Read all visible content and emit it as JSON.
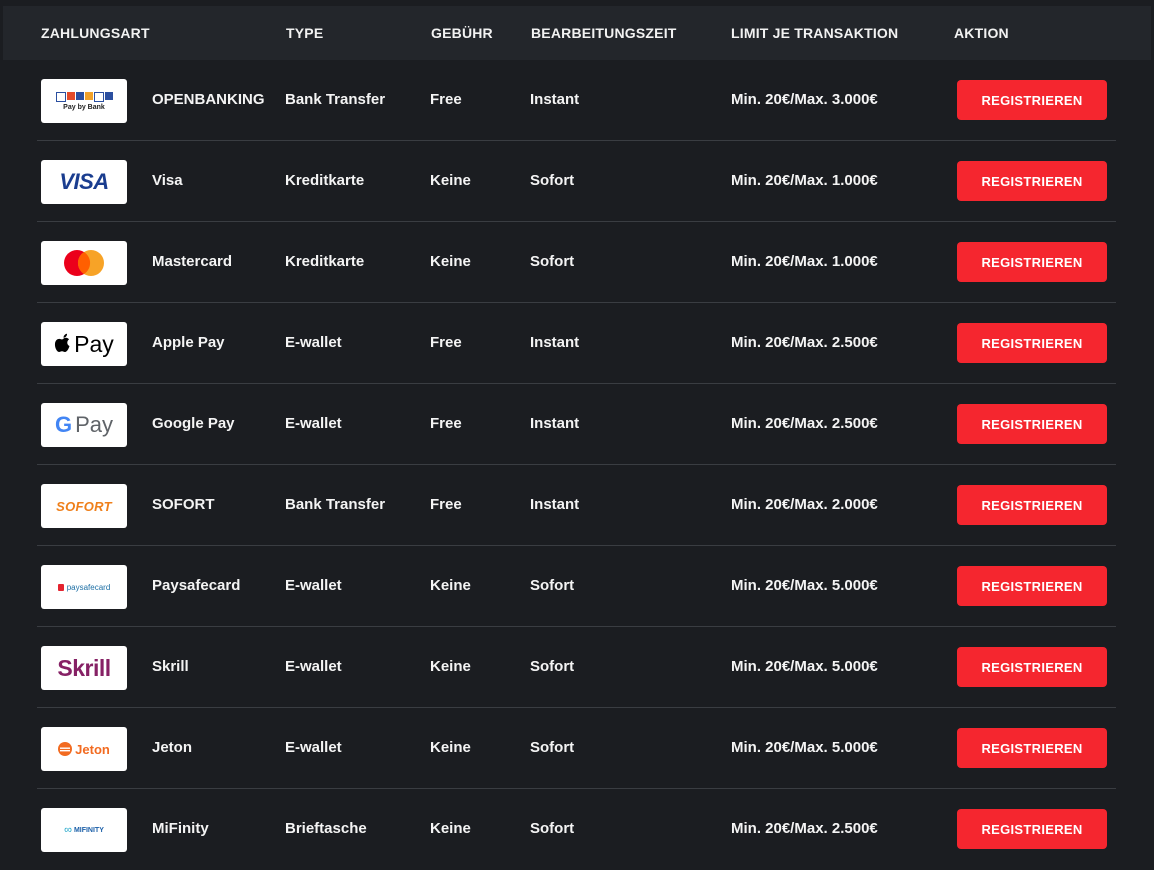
{
  "header": {
    "zahlungsart": "ZAHLUNGSART",
    "type": "TYPE",
    "gebuehr": "GEBÜHR",
    "bearbeitungszeit": "BEARBEITUNGSZEIT",
    "limit": "LIMIT JE TRANSAKTION",
    "aktion": "AKTION"
  },
  "colors": {
    "button": "#f5262f",
    "background": "#1b1d21",
    "header": "#23262b",
    "divider": "#3a3d42"
  },
  "rows": [
    {
      "name": "OPENBANKING",
      "type": "Bank Transfer",
      "fee": "Free",
      "time": "Instant",
      "limit": "Min. 20€/Max. 3.000€",
      "action": "REGISTRIEREN",
      "logo_icon": "pay-by-bank-icon",
      "logo_text": "Pay by Bank"
    },
    {
      "name": "Visa",
      "type": "Kreditkarte",
      "fee": "Keine",
      "time": "Sofort",
      "limit": "Min. 20€/Max. 1.000€",
      "action": "REGISTRIEREN",
      "logo_icon": "visa-icon",
      "logo_text": "VISA"
    },
    {
      "name": "Mastercard",
      "type": "Kreditkarte",
      "fee": "Keine",
      "time": "Sofort",
      "limit": "Min. 20€/Max. 1.000€",
      "action": "REGISTRIEREN",
      "logo_icon": "mastercard-icon",
      "logo_text": ""
    },
    {
      "name": "Apple Pay",
      "type": "E-wallet",
      "fee": "Free",
      "time": "Instant",
      "limit": "Min. 20€/Max. 2.500€",
      "action": "REGISTRIEREN",
      "logo_icon": "apple-pay-icon",
      "logo_text": "Pay"
    },
    {
      "name": "Google Pay",
      "type": "E-wallet",
      "fee": "Free",
      "time": "Instant",
      "limit": "Min. 20€/Max. 2.500€",
      "action": "REGISTRIEREN",
      "logo_icon": "google-pay-icon",
      "logo_text": "Pay"
    },
    {
      "name": "SOFORT",
      "type": "Bank Transfer",
      "fee": "Free",
      "time": "Instant",
      "limit": "Min. 20€/Max. 2.000€",
      "action": "REGISTRIEREN",
      "logo_icon": "sofort-icon",
      "logo_text": "SOFORT"
    },
    {
      "name": "Paysafecard",
      "type": "E-wallet",
      "fee": "Keine",
      "time": "Sofort",
      "limit": "Min. 20€/Max. 5.000€",
      "action": "REGISTRIEREN",
      "logo_icon": "paysafecard-icon",
      "logo_text": "paysafecard"
    },
    {
      "name": "Skrill",
      "type": "E-wallet",
      "fee": "Keine",
      "time": "Sofort",
      "limit": "Min. 20€/Max. 5.000€",
      "action": "REGISTRIEREN",
      "logo_icon": "skrill-icon",
      "logo_text": "Skrill"
    },
    {
      "name": "Jeton",
      "type": "E-wallet",
      "fee": "Keine",
      "time": "Sofort",
      "limit": "Min. 20€/Max. 5.000€",
      "action": "REGISTRIEREN",
      "logo_icon": "jeton-icon",
      "logo_text": "Jeton"
    },
    {
      "name": "MiFinity",
      "type": "Brieftasche",
      "fee": "Keine",
      "time": "Sofort",
      "limit": "Min. 20€/Max. 2.500€",
      "action": "REGISTRIEREN",
      "logo_icon": "mifinity-icon",
      "logo_text": "MIFINITY"
    }
  ]
}
